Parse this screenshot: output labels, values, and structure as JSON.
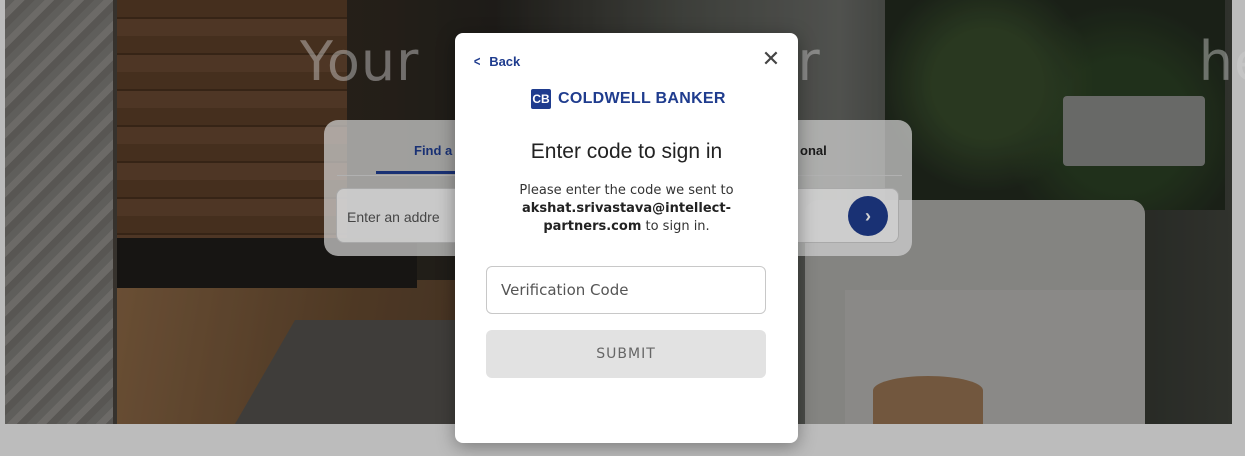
{
  "hero": {
    "title": "Your r here"
  },
  "search": {
    "tab_find": "Find a",
    "tab_professional": "onal",
    "placeholder": "Enter an addre",
    "go_glyph": "›"
  },
  "modal": {
    "back_label": "Back",
    "back_glyph": "<",
    "close_glyph": "✕",
    "brand_mark": "CB",
    "brand_name": "COLDWELL BANKER",
    "title": "Enter code to sign in",
    "instructions_pre": "Please enter the code we sent to",
    "email": "akshat.srivastava@intellect-partners.com",
    "instructions_post": "to sign in.",
    "code_placeholder": "Verification Code",
    "submit_label": "SUBMIT"
  },
  "colors": {
    "brand": "#1f3c8e",
    "submit_disabled": "#e2e2e2"
  }
}
